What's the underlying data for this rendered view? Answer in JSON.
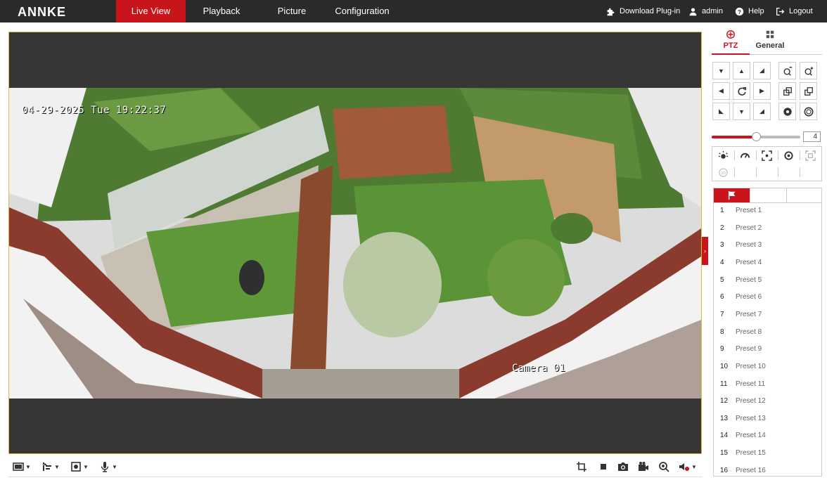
{
  "brand": {
    "logo": "ANNKE"
  },
  "nav": {
    "tabs": [
      {
        "label": "Live View",
        "active": true
      },
      {
        "label": "Playback",
        "active": false
      },
      {
        "label": "Picture",
        "active": false
      },
      {
        "label": "Configuration",
        "active": false
      }
    ],
    "right": {
      "plugin": "Download Plug-in",
      "user": "admin",
      "help": "Help",
      "logout": "Logout"
    }
  },
  "video": {
    "osd_datetime": "04-29-2025 Tue 19:22:37",
    "osd_camera": "Camera 01"
  },
  "panel": {
    "tabs": [
      {
        "label": "PTZ",
        "icon": "crosshair-icon",
        "active": true
      },
      {
        "label": "General",
        "icon": "grid-icon",
        "active": false
      }
    ],
    "speed": {
      "value": "4",
      "level_fraction": 0.5
    },
    "presets": [
      {
        "num": "1",
        "name": "Preset 1"
      },
      {
        "num": "2",
        "name": "Preset 2"
      },
      {
        "num": "3",
        "name": "Preset 3"
      },
      {
        "num": "4",
        "name": "Preset 4"
      },
      {
        "num": "5",
        "name": "Preset 5"
      },
      {
        "num": "6",
        "name": "Preset 6"
      },
      {
        "num": "7",
        "name": "Preset 7"
      },
      {
        "num": "8",
        "name": "Preset 8"
      },
      {
        "num": "9",
        "name": "Preset 9"
      },
      {
        "num": "10",
        "name": "Preset 10"
      },
      {
        "num": "11",
        "name": "Preset 11"
      },
      {
        "num": "12",
        "name": "Preset 12"
      },
      {
        "num": "13",
        "name": "Preset 13"
      },
      {
        "num": "14",
        "name": "Preset 14"
      },
      {
        "num": "15",
        "name": "Preset 15"
      },
      {
        "num": "16",
        "name": "Preset 16"
      }
    ]
  },
  "colors": {
    "accent": "#c8151b",
    "topbar": "#2a2a2a",
    "video_border": "#e2b93b",
    "video_bg": "#363636"
  }
}
